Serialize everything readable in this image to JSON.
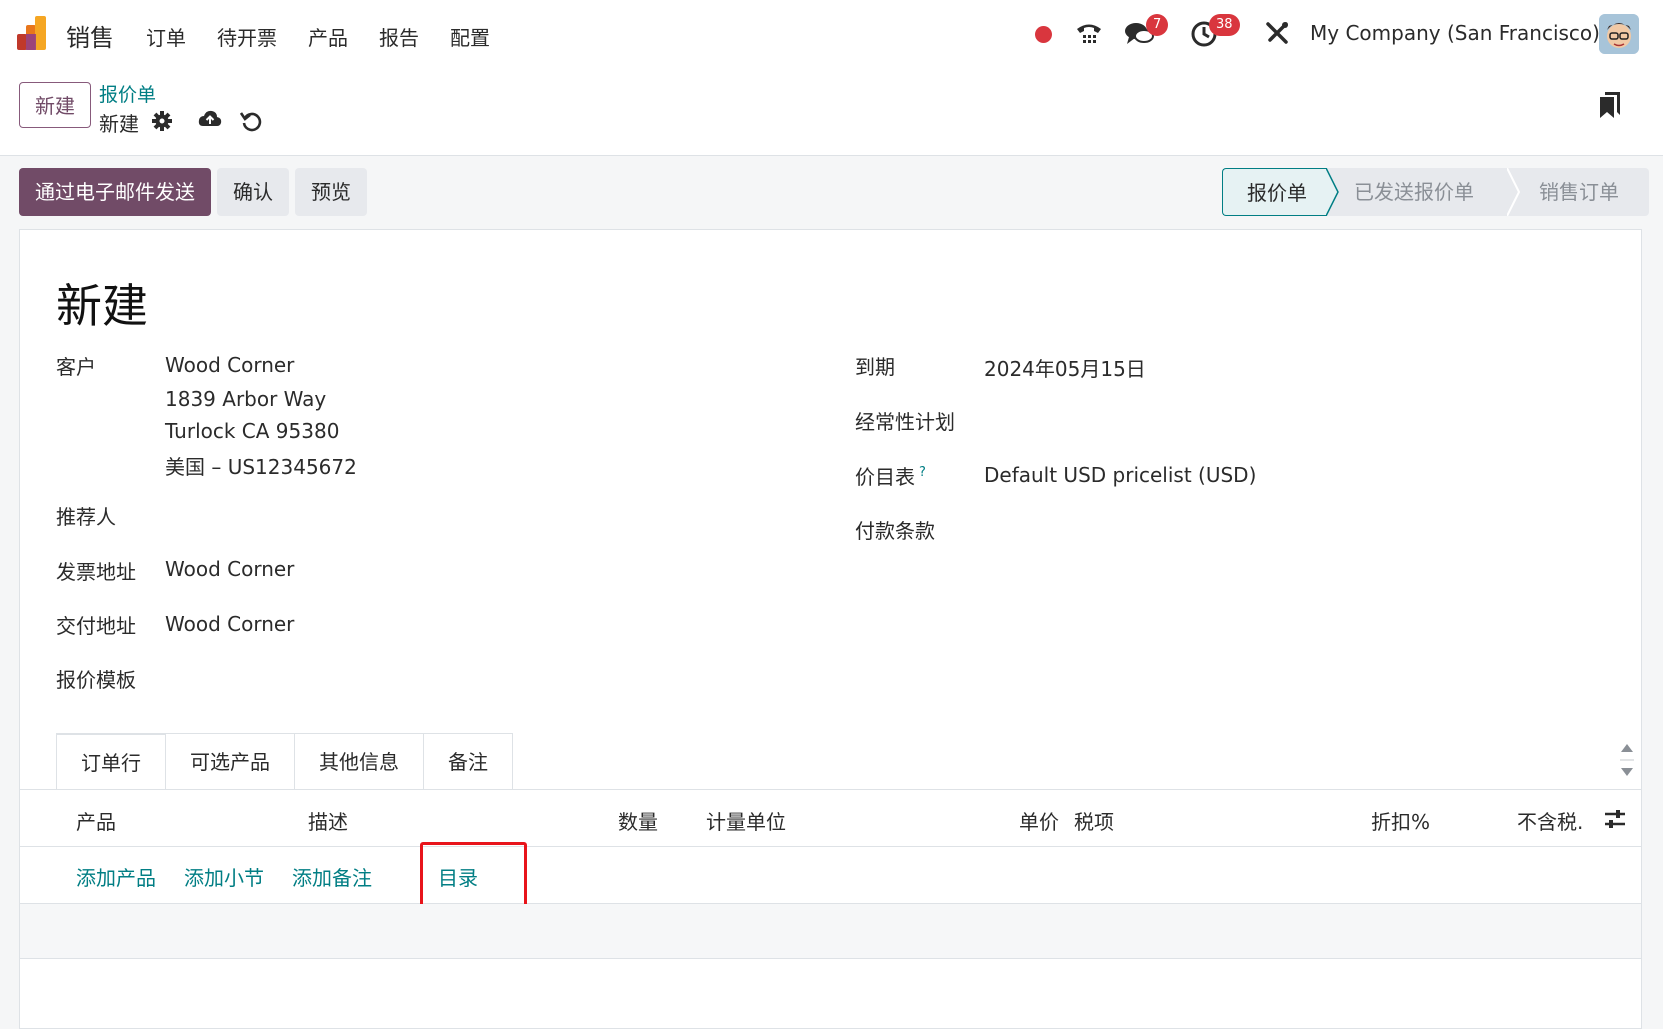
{
  "navbar": {
    "app_name": "销售",
    "menu": [
      "订单",
      "待开票",
      "产品",
      "报告",
      "配置"
    ],
    "messages_badge": "7",
    "activities_badge": "38",
    "company": "My Company (San Francisco)"
  },
  "control_panel": {
    "new_button": "新建",
    "breadcrumb": "报价单",
    "record_name": "新建"
  },
  "actions": {
    "send_email": "通过电子邮件发送",
    "confirm": "确认",
    "preview": "预览"
  },
  "status_stages": [
    "报价单",
    "已发送报价单",
    "销售订单"
  ],
  "form": {
    "title": "新建",
    "customer_label": "客户",
    "customer_lines": [
      "Wood Corner",
      "1839 Arbor Way",
      "Turlock CA 95380",
      "美国 – US12345672"
    ],
    "referrer_label": "推荐人",
    "invoice_address_label": "发票地址",
    "invoice_address": "Wood Corner",
    "delivery_address_label": "交付地址",
    "delivery_address": "Wood Corner",
    "quote_template_label": "报价模板",
    "expiration_label": "到期",
    "expiration": "2024年05月15日",
    "recurring_plan_label": "经常性计划",
    "pricelist_label": "价目表",
    "pricelist_help": "?",
    "pricelist": "Default USD pricelist (USD)",
    "payment_terms_label": "付款条款"
  },
  "tabs": [
    "订单行",
    "可选产品",
    "其他信息",
    "备注"
  ],
  "order_lines": {
    "columns": [
      "产品",
      "描述",
      "数量",
      "计量单位",
      "单价",
      "税项",
      "折扣%",
      "不含税."
    ],
    "add_links": [
      "添加产品",
      "添加小节",
      "添加备注",
      "目录"
    ]
  },
  "colors": {
    "brand": "#714b67",
    "link": "#017e84",
    "badge": "#d9363e",
    "highlight": "#e8141b"
  }
}
